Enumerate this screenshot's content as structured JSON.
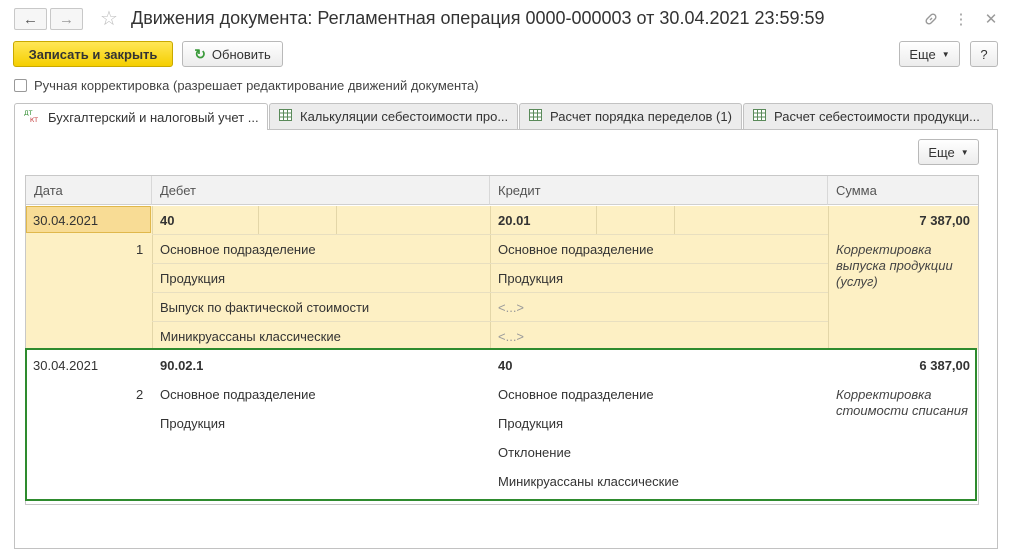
{
  "window": {
    "title": "Движения документа: Регламентная операция 0000-000003 от 30.04.2021 23:59:59"
  },
  "toolbar": {
    "save_close": "Записать и закрыть",
    "refresh": "Обновить",
    "more": "Еще",
    "help": "?"
  },
  "manual_edit": {
    "label": "Ручная корректировка (разрешает редактирование движений документа)",
    "checked": false
  },
  "tabs": [
    {
      "label": "Бухгалтерский и налоговый учет ...",
      "icon": "dt-kt-icon",
      "active": true
    },
    {
      "label": "Калькуляции себестоимости про...",
      "icon": "table-icon",
      "active": false
    },
    {
      "label": "Расчет порядка переделов (1)",
      "icon": "table-icon",
      "active": false
    },
    {
      "label": "Расчет себестоимости продукци...",
      "icon": "table-icon",
      "active": false
    }
  ],
  "panel": {
    "more": "Еще"
  },
  "table": {
    "columns": [
      "Дата",
      "Дебет",
      "Кредит",
      "Сумма"
    ],
    "rows": [
      {
        "date": "30.04.2021",
        "num": "1",
        "debit_account": "40",
        "debit_sub": [
          "Основное подразделение",
          "Продукция",
          "Выпуск по фактической стоимости",
          "Миникруассаны классические"
        ],
        "credit_account": "20.01",
        "credit_sub": [
          "Основное подразделение",
          "Продукция",
          "<...>",
          "<...>"
        ],
        "amount": "7 387,00",
        "comment": [
          "Корректировка",
          "выпуска продукции",
          "(услуг)"
        ]
      },
      {
        "date": "30.04.2021",
        "num": "2",
        "debit_account": "90.02.1",
        "debit_sub": [
          "Основное подразделение",
          "Продукция"
        ],
        "credit_account": "40",
        "credit_sub": [
          "Основное подразделение",
          "Продукция",
          "Отклонение",
          "Миникруассаны классические"
        ],
        "amount": "6 387,00",
        "comment": [
          "Корректировка",
          "стоимости списания"
        ]
      }
    ]
  },
  "colors": {
    "accent_yellow": "#f5cf00",
    "selected_row": "#fdf0c4",
    "highlight_border": "#2e8b2e"
  }
}
